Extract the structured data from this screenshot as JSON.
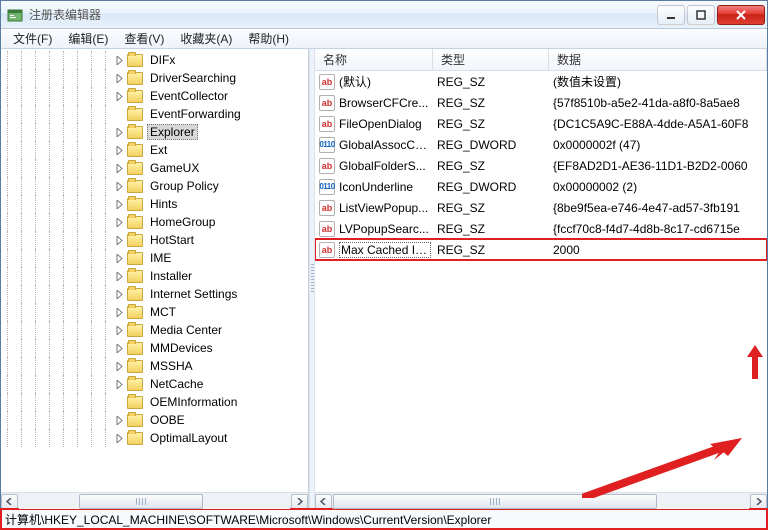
{
  "window": {
    "title": "注册表编辑器"
  },
  "menu": {
    "file": "文件(F)",
    "edit": "编辑(E)",
    "view": "查看(V)",
    "fav": "收藏夹(A)",
    "help": "帮助(H)"
  },
  "tree": {
    "items": [
      {
        "label": "DIFx",
        "exp": "closed"
      },
      {
        "label": "DriverSearching",
        "exp": "closed"
      },
      {
        "label": "EventCollector",
        "exp": "closed"
      },
      {
        "label": "EventForwarding",
        "exp": "none"
      },
      {
        "label": "Explorer",
        "exp": "closed",
        "selected": true
      },
      {
        "label": "Ext",
        "exp": "closed"
      },
      {
        "label": "GameUX",
        "exp": "closed"
      },
      {
        "label": "Group Policy",
        "exp": "closed"
      },
      {
        "label": "Hints",
        "exp": "closed"
      },
      {
        "label": "HomeGroup",
        "exp": "closed"
      },
      {
        "label": "HotStart",
        "exp": "closed"
      },
      {
        "label": "IME",
        "exp": "closed"
      },
      {
        "label": "Installer",
        "exp": "closed"
      },
      {
        "label": "Internet Settings",
        "exp": "closed"
      },
      {
        "label": "MCT",
        "exp": "closed"
      },
      {
        "label": "Media Center",
        "exp": "closed"
      },
      {
        "label": "MMDevices",
        "exp": "closed"
      },
      {
        "label": "MSSHA",
        "exp": "closed"
      },
      {
        "label": "NetCache",
        "exp": "closed"
      },
      {
        "label": "OEMInformation",
        "exp": "none"
      },
      {
        "label": "OOBE",
        "exp": "closed"
      },
      {
        "label": "OptimalLayout",
        "exp": "closed"
      }
    ]
  },
  "list": {
    "headers": {
      "name": "名称",
      "type": "类型",
      "data": "数据"
    },
    "rows": [
      {
        "icon": "str",
        "name": "(默认)",
        "type": "REG_SZ",
        "data": "(数值未设置)"
      },
      {
        "icon": "str",
        "name": "BrowserCFCre...",
        "type": "REG_SZ",
        "data": "{57f8510b-a5e2-41da-a8f0-8a5ae8"
      },
      {
        "icon": "str",
        "name": "FileOpenDialog",
        "type": "REG_SZ",
        "data": "{DC1C5A9C-E88A-4dde-A5A1-60F8"
      },
      {
        "icon": "bin",
        "name": "GlobalAssocCh...",
        "type": "REG_DWORD",
        "data": "0x0000002f (47)"
      },
      {
        "icon": "str",
        "name": "GlobalFolderS...",
        "type": "REG_SZ",
        "data": "{EF8AD2D1-AE36-11D1-B2D2-0060"
      },
      {
        "icon": "bin",
        "name": "IconUnderline",
        "type": "REG_DWORD",
        "data": "0x00000002 (2)"
      },
      {
        "icon": "str",
        "name": "ListViewPopup...",
        "type": "REG_SZ",
        "data": "{8be9f5ea-e746-4e47-ad57-3fb191"
      },
      {
        "icon": "str",
        "name": "LVPopupSearc...",
        "type": "REG_SZ",
        "data": "{fccf70c8-f4d7-4d8b-8c17-cd6715e"
      },
      {
        "icon": "str",
        "name": "Max Cached Ic...",
        "type": "REG_SZ",
        "data": "2000",
        "highlight": true
      }
    ]
  },
  "status": {
    "path": "计算机\\HKEY_LOCAL_MACHINE\\SOFTWARE\\Microsoft\\Windows\\CurrentVersion\\Explorer"
  },
  "icons": {
    "str": "ab",
    "bin": "011\n110"
  }
}
